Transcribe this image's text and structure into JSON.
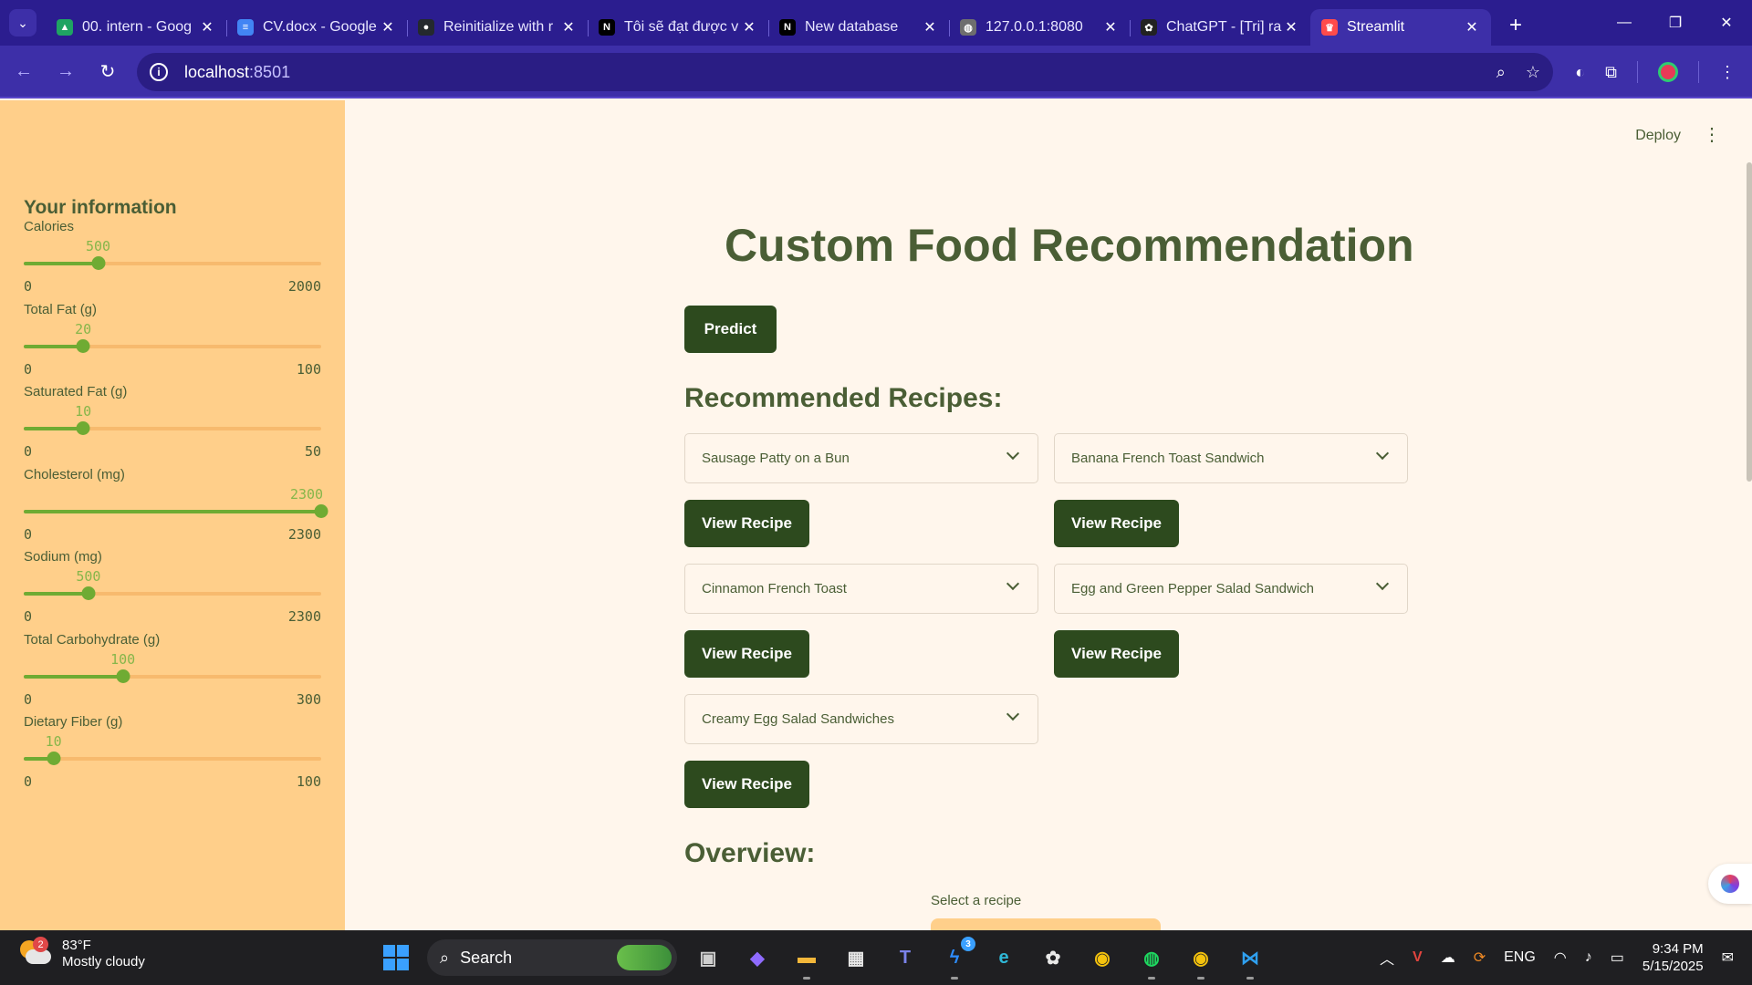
{
  "browser": {
    "tabs": [
      {
        "title": "00. intern - Goog",
        "icon": "google-drive-icon",
        "color": "#1fa463",
        "glyph": "▲"
      },
      {
        "title": "CV.docx - Google",
        "icon": "google-docs-icon",
        "color": "#4285f4",
        "glyph": "≡"
      },
      {
        "title": "Reinitialize with r",
        "icon": "github-icon",
        "color": "#24292e",
        "glyph": "●"
      },
      {
        "title": "Tôi sẽ đạt được v",
        "icon": "notion-icon",
        "color": "#000000",
        "glyph": "N"
      },
      {
        "title": "New database",
        "icon": "notion-icon",
        "color": "#000000",
        "glyph": "N"
      },
      {
        "title": "127.0.0.1:8080",
        "icon": "globe-icon",
        "color": "#6e6e6e",
        "glyph": "◍"
      },
      {
        "title": "ChatGPT - [Tri] ra",
        "icon": "chatgpt-icon",
        "color": "#222222",
        "glyph": "✿"
      },
      {
        "title": "Streamlit",
        "icon": "streamlit-icon",
        "color": "#ff4b4b",
        "glyph": "♛"
      }
    ],
    "new_tab": "+",
    "url_host": "localhost",
    "url_port": ":8501"
  },
  "sidebar": {
    "title": "Your information",
    "sliders": [
      {
        "label": "Calories",
        "value": 500,
        "min": 0,
        "max": 2000
      },
      {
        "label": "Total Fat (g)",
        "value": 20,
        "min": 0,
        "max": 100
      },
      {
        "label": "Saturated Fat (g)",
        "value": 10,
        "min": 0,
        "max": 50
      },
      {
        "label": "Cholesterol (mg)",
        "value": 2300,
        "min": 0,
        "max": 2300
      },
      {
        "label": "Sodium (mg)",
        "value": 500,
        "min": 0,
        "max": 2300
      },
      {
        "label": "Total Carbohydrate (g)",
        "value": 100,
        "min": 0,
        "max": 300
      },
      {
        "label": "Dietary Fiber (g)",
        "value": 10,
        "min": 0,
        "max": 100
      }
    ]
  },
  "main": {
    "deploy": "Deploy",
    "title": "Custom Food Recommendation",
    "predict": "Predict",
    "recommended_heading": "Recommended Recipes:",
    "view_recipe": "View Recipe",
    "recipes": [
      "Sausage Patty on a Bun",
      "Banana French Toast Sandwich",
      "Cinnamon French Toast",
      "Egg and Green Pepper Salad Sandwich",
      "Creamy Egg Salad Sandwiches"
    ],
    "overview_heading": "Overview:",
    "select_caption": "Select a recipe"
  },
  "taskbar": {
    "temperature": "83°F",
    "condition": "Mostly cloudy",
    "weather_badge": "2",
    "search": "Search",
    "messenger_badge": "3",
    "language": "ENG",
    "time": "9:34 PM",
    "date": "5/15/2025"
  },
  "colors": {
    "sidebar_bg": "#ffcf8a",
    "main_bg": "#fff6ec",
    "primary_text": "#4a5e35",
    "button_bg": "#2d4a1e",
    "slider_fill": "#6fab33",
    "browser_frame": "#2b1d8f"
  }
}
